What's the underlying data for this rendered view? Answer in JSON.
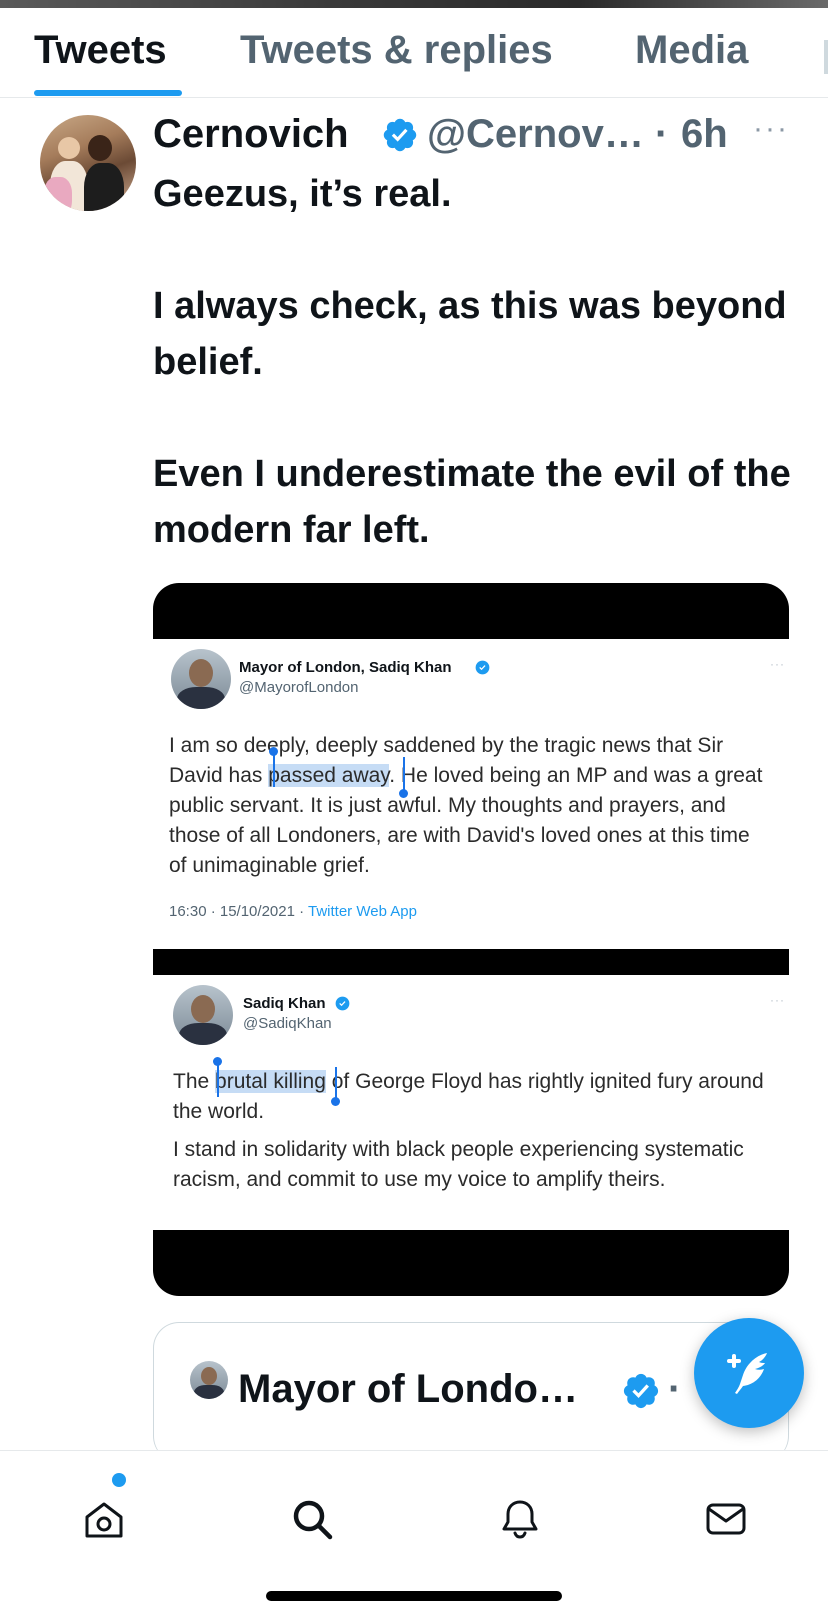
{
  "tabs": [
    {
      "label": "Tweets",
      "active": true
    },
    {
      "label": "Tweets & replies",
      "active": false
    },
    {
      "label": "Media",
      "active": false
    }
  ],
  "tweet": {
    "name": "Cernovich",
    "handle": "@Cernov…",
    "separator": "·",
    "time": "6h",
    "more": "···",
    "paragraphs": [
      "Geezus, it’s real.",
      "I always check, as this was beyond belief.",
      "Even I underestimate the evil of the modern far left."
    ]
  },
  "media": {
    "card1": {
      "name": "Mayor of London, Sadiq Khan",
      "handle": "@MayorofLondon",
      "more": "···",
      "text_before": "I am so deeply, deeply saddened by the tragic news that Sir David has ",
      "text_highlight": "passed away",
      "text_after": ". He loved being an MP and was a great public servant. It is just awful. My thoughts and prayers, and those of all Londoners, are with David's loved ones at this time of unimaginable grief.",
      "meta_time": "16:30 · 15/10/2021 · ",
      "meta_app": "Twitter Web App"
    },
    "card2": {
      "name": "Sadiq Khan",
      "handle": "@SadiqKhan",
      "more": "···",
      "p1_before": "The ",
      "p1_highlight": "brutal killing",
      "p1_after": " of George Floyd has rightly ignited fury around the world.",
      "p2": "I stand in solidarity with black people experiencing systematic racism, and commit to use my voice to amplify theirs."
    }
  },
  "quote": {
    "name": "Mayor of Londo…",
    "separator": "·"
  },
  "icons": {
    "verified": "verified-badge-icon",
    "compose": "compose-tweet-icon",
    "home": "home-icon",
    "search": "search-icon",
    "notifications": "bell-icon",
    "messages": "mail-icon"
  },
  "colors": {
    "accent": "#1d9bf0",
    "text": "#0f1419",
    "secondary": "#536471"
  }
}
